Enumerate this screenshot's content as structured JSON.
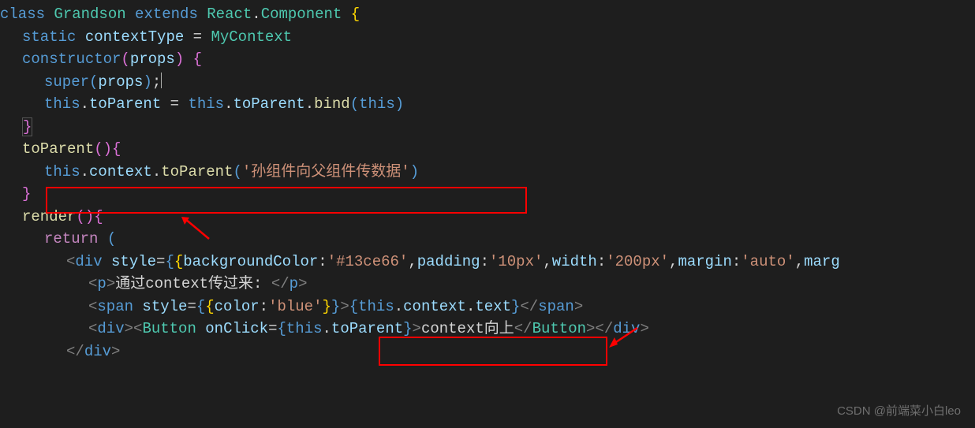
{
  "code": {
    "line1_class": "class",
    "line1_name": "Grandson",
    "line1_extends": "extends",
    "line1_react": "React",
    "line1_component": "Component",
    "line2_static": "static",
    "line2_contextType": "contextType",
    "line2_eq": "=",
    "line2_mycontext": "MyContext",
    "line3_constructor": "constructor",
    "line3_props": "props",
    "line4_super": "super",
    "line4_props": "props",
    "line5_this": "this",
    "line5_toParent": "toParent",
    "line5_eq": "=",
    "line5_this2": "this",
    "line5_toParent2": "toParent",
    "line5_bind": "bind",
    "line5_this3": "this",
    "line7_toParent": "toParent",
    "line8_this": "this",
    "line8_context": "context",
    "line8_toParent": "toParent",
    "line8_string": "'孙组件向父组件传数据'",
    "line10_render": "render",
    "line11_return": "return",
    "line12_div": "div",
    "line12_style": "style",
    "line12_bgcolor": "backgroundColor",
    "line12_bgval": "'#13ce66'",
    "line12_padding": "padding",
    "line12_padval": "'10px'",
    "line12_width": "width",
    "line12_widthval": "'200px'",
    "line12_margin": "margin",
    "line12_marginval": "'auto'",
    "line12_marg2": "marg",
    "line13_p": "p",
    "line13_text": "通过context传过来: ",
    "line14_span": "span",
    "line14_style": "style",
    "line14_color": "color",
    "line14_colorval": "'blue'",
    "line14_this": "this",
    "line14_context": "context",
    "line14_textprop": "text",
    "line15_div": "div",
    "line15_button": "Button",
    "line15_onclick": "onClick",
    "line15_this": "this",
    "line15_toParent": "toParent",
    "line15_text": "context向上",
    "line16_div": "div"
  },
  "watermark": "CSDN @前端菜小白leo"
}
